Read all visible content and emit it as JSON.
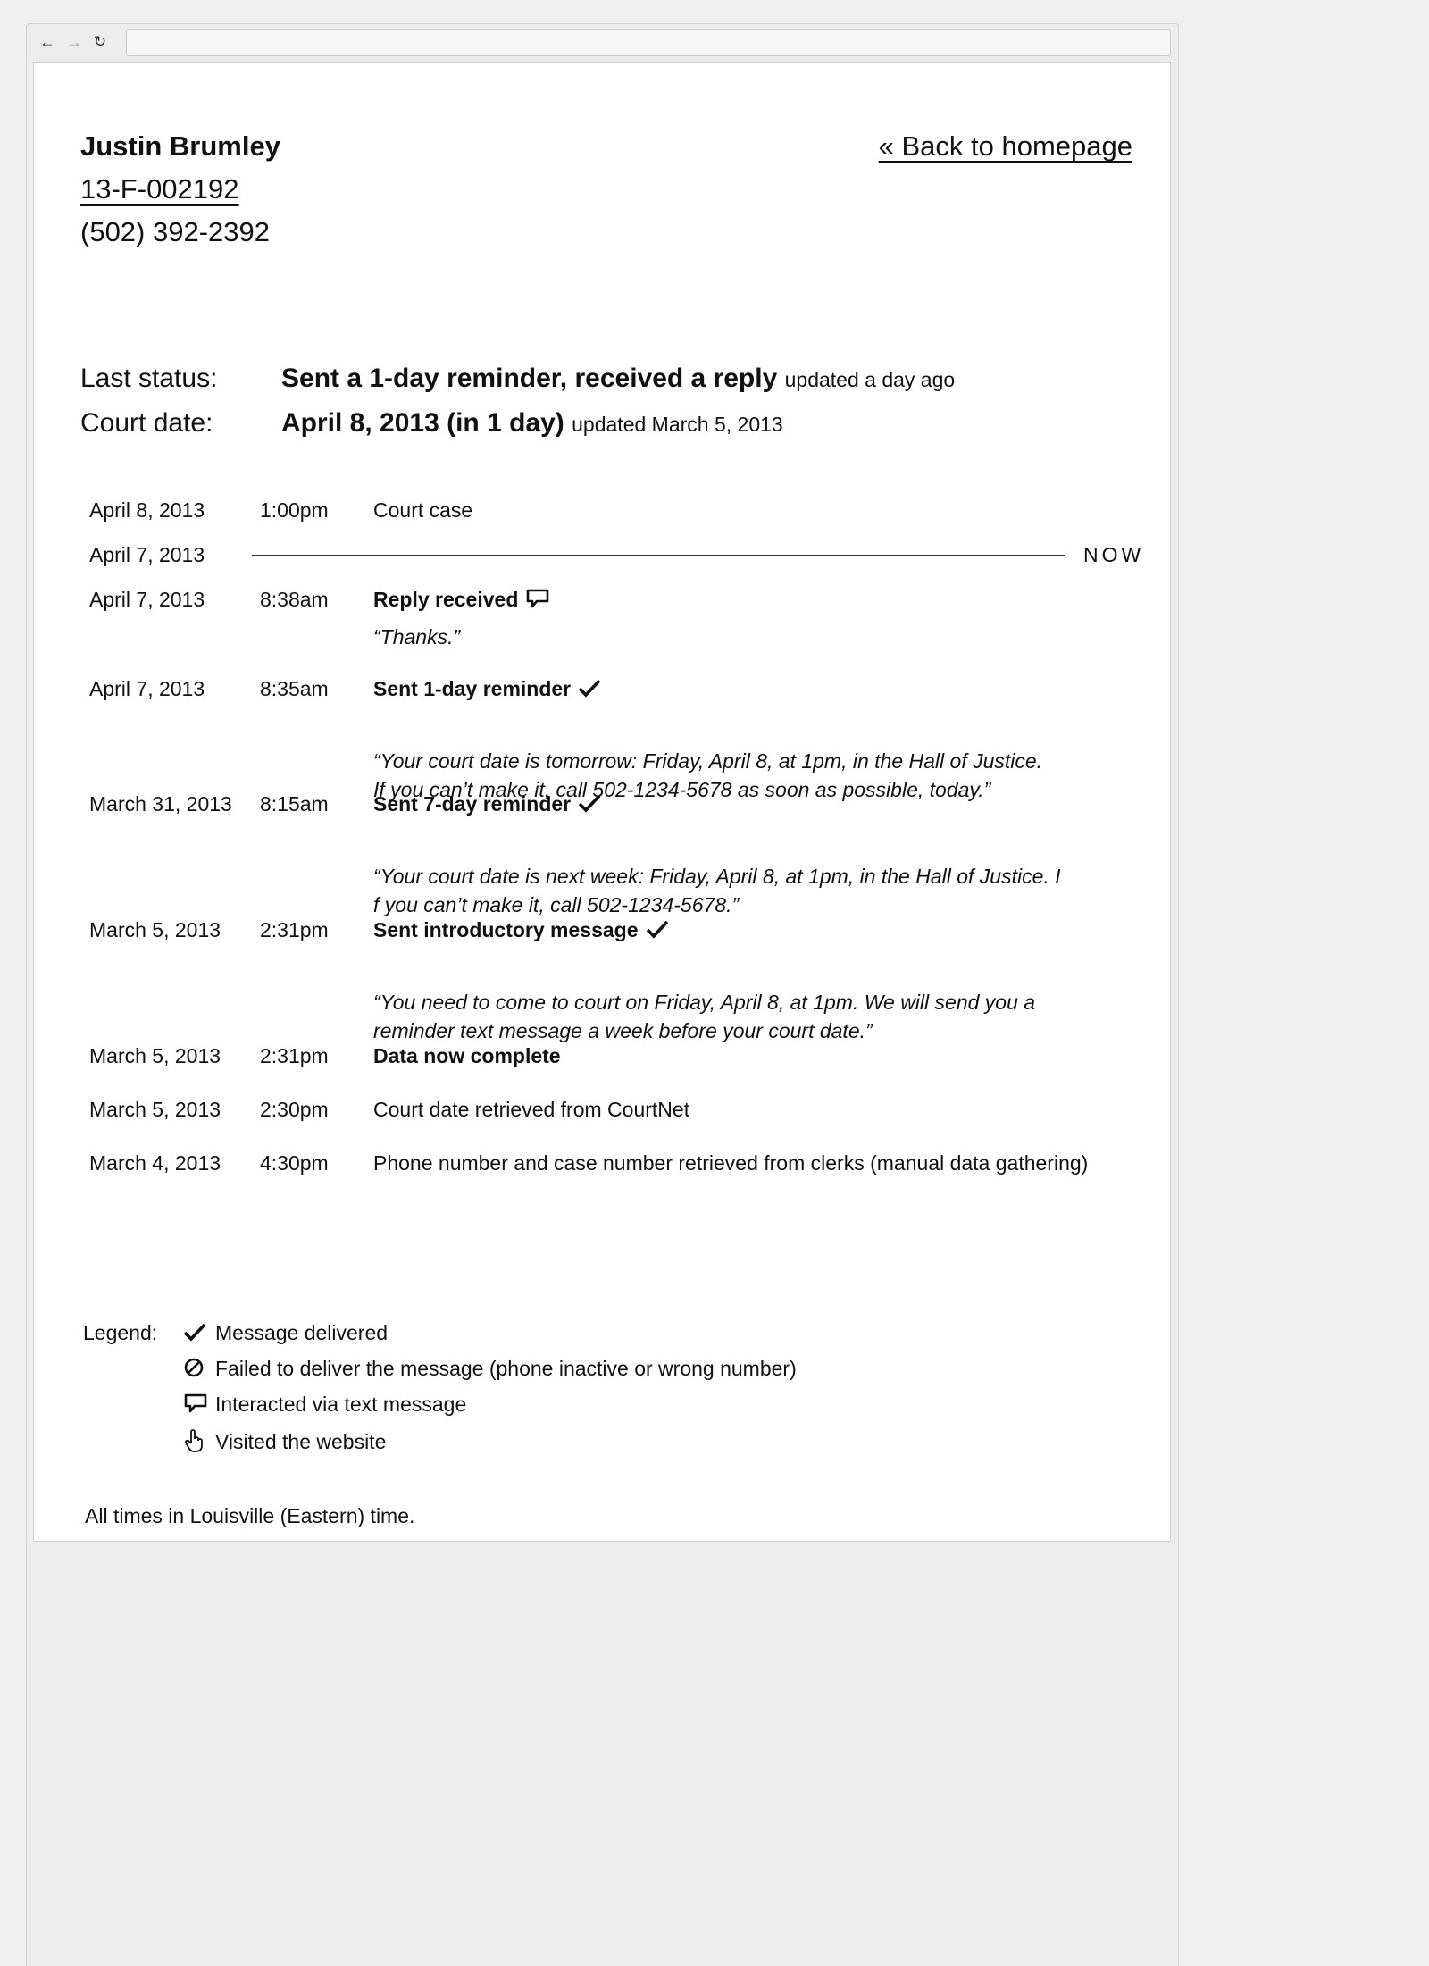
{
  "browser": {
    "back_icon": "arrow-left-icon",
    "forward_icon": "arrow-right-icon",
    "reload_icon": "reload-icon",
    "address": ""
  },
  "client": {
    "name": "Justin Brumley",
    "case_number": "13-F-002192",
    "phone": "(502) 392-2392"
  },
  "back_link": "« Back to homepage",
  "status": {
    "last_status_label": "Last status:",
    "last_status_value": "Sent a 1-day reminder, received a reply",
    "last_status_updated": "updated a day ago",
    "court_date_label": "Court date:",
    "court_date_value": "April 8, 2013 (in 1 day)",
    "court_date_updated": "updated March 5, 2013"
  },
  "timeline": {
    "court_case": {
      "date": "April 8, 2013",
      "time": "1:00pm",
      "title": "Court case"
    },
    "now": {
      "date": "April 7, 2013",
      "label": "NOW"
    },
    "reply": {
      "date": "April 7, 2013",
      "time": "8:38am",
      "title": "Reply received",
      "icon": "speech-bubble-icon",
      "message": "“Thanks.”"
    },
    "reminder_1": {
      "date": "April 7, 2013",
      "time": "8:35am",
      "title": "Sent 1-day reminder",
      "icon": "checkmark-icon",
      "message_line1": "“Your court date is tomorrow: Friday, April 8, at 1pm, in the Hall of Justice.",
      "message_line2": "If you can’t make it, call 502-1234-5678 as soon as possible, today.”"
    },
    "reminder_7": {
      "date": "March 31, 2013",
      "time": "8:15am",
      "title": "Sent 7-day reminder",
      "icon": "checkmark-icon",
      "message_line1": "“Your court date is next week: Friday, April 8, at 1pm, in the Hall of Justice. I",
      "message_line2": "f you can’t make it, call 502-1234-5678.”"
    },
    "intro": {
      "date": "March 5, 2013",
      "time": "2:31pm",
      "title": "Sent introductory message",
      "icon": "checkmark-icon",
      "message_line1": "“You need to come to court on Friday, April 8, at 1pm. We will send you a",
      "message_line2": "reminder text message a week before your court date.”"
    },
    "data_complete": {
      "date": "March 5, 2013",
      "time": "2:31pm",
      "title": "Data now complete"
    },
    "courtnet": {
      "date": "March 5, 2013",
      "time": "2:30pm",
      "title": "Court date retrieved from CourtNet"
    },
    "clerks": {
      "date": "March 4, 2013",
      "time": "4:30pm",
      "title": "Phone number and case number retrieved from clerks (manual data gathering)"
    }
  },
  "legend": {
    "label": "Legend:",
    "delivered": {
      "icon": "checkmark-icon",
      "text": "Message delivered"
    },
    "failed": {
      "icon": "prohibited-icon",
      "text": "Failed to deliver the message (phone inactive or wrong number)"
    },
    "interacted": {
      "icon": "speech-bubble-icon",
      "text": "Interacted via text message"
    },
    "visited": {
      "icon": "pointer-hand-icon",
      "text": "Visited the website"
    }
  },
  "footer_note": "All times in Louisville (Eastern) time."
}
